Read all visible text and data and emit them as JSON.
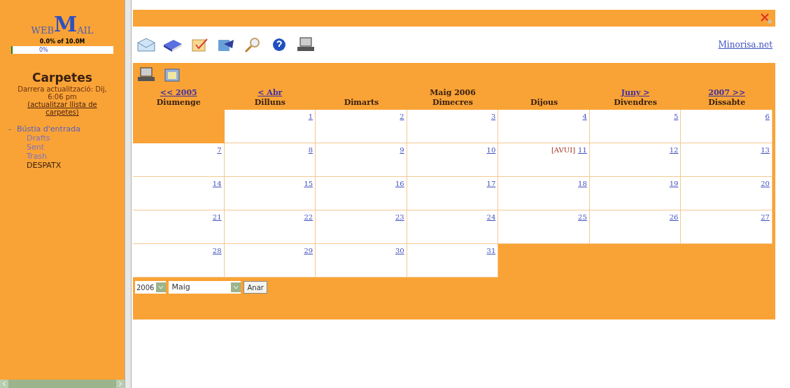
{
  "sidebar": {
    "logo": {
      "small1": "WEB",
      "big": "M",
      "small2": "AIL"
    },
    "quota": {
      "label": "0.0% of 10.0M",
      "reading": "0%",
      "level": 0.0
    },
    "title": "Carpetes",
    "updated": "Darrera actualització: Dij, 6:06 pm",
    "refresh_link": "(actualitzar llista de carpetes)",
    "folders": [
      {
        "expander": "-",
        "label": "Bústia d'entrada",
        "expanded": true,
        "selected": false,
        "children": [
          {
            "label": "Drafts",
            "selected": false
          },
          {
            "label": "Sent",
            "selected": false
          },
          {
            "label": "Trash",
            "selected": false
          },
          {
            "label": "DESPATX",
            "selected": true
          }
        ]
      }
    ]
  },
  "site_link": "Minorisa.net",
  "calendar": {
    "nav": {
      "prev_year": "<< 2005",
      "prev_month": "< Abr",
      "title": "Maig 2006",
      "next_month": "Juny >",
      "next_year": "2007 >>"
    },
    "weekdays": [
      "Diumenge",
      "Dilluns",
      "Dimarts",
      "Dimecres",
      "Dijous",
      "Divendres",
      "Dissabte"
    ],
    "weeks": [
      [
        {
          "kind": "blank"
        },
        {
          "day": "1"
        },
        {
          "day": "2"
        },
        {
          "day": "3"
        },
        {
          "day": "4"
        },
        {
          "day": "5"
        },
        {
          "day": "6"
        }
      ],
      [
        {
          "day": "7"
        },
        {
          "day": "8"
        },
        {
          "day": "9"
        },
        {
          "day": "10"
        },
        {
          "day": "11",
          "today_label": "[AVUI]"
        },
        {
          "day": "12"
        },
        {
          "day": "13"
        }
      ],
      [
        {
          "day": "14"
        },
        {
          "day": "15"
        },
        {
          "day": "16"
        },
        {
          "day": "17"
        },
        {
          "day": "18"
        },
        {
          "day": "19"
        },
        {
          "day": "20"
        }
      ],
      [
        {
          "day": "21"
        },
        {
          "day": "22"
        },
        {
          "day": "23"
        },
        {
          "day": "24"
        },
        {
          "day": "25"
        },
        {
          "day": "26"
        },
        {
          "day": "27"
        }
      ],
      [
        {
          "day": "28"
        },
        {
          "day": "29"
        },
        {
          "day": "30"
        },
        {
          "day": "31"
        },
        {
          "kind": "blank"
        },
        {
          "kind": "blank"
        },
        {
          "kind": "blank"
        }
      ]
    ],
    "year_select": "2006",
    "month_select": "Maig",
    "go_button": "Anar"
  }
}
